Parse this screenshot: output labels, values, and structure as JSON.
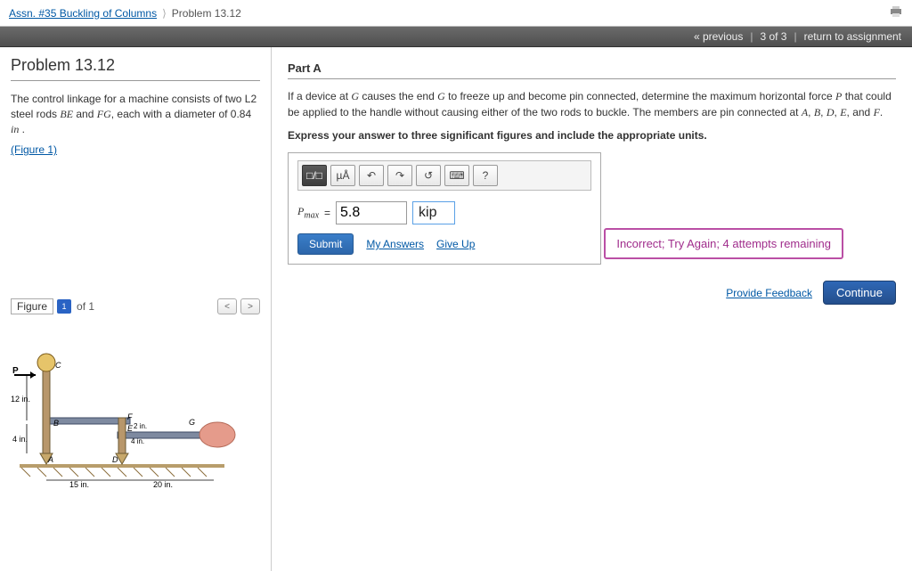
{
  "breadcrumb": {
    "assignment": "Assn. #35 Buckling of Columns",
    "here": "Problem 13.12"
  },
  "navbar": {
    "prev": "« previous",
    "pos": "3 of 3",
    "ret": "return to assignment"
  },
  "problem": {
    "title": "Problem 13.12",
    "statement_a": "The control linkage for a machine consists of two L2 steel rods ",
    "rod1": "BE",
    "statement_b": " and ",
    "rod2": "FG",
    "statement_c": ", each with a diameter of 0.84 ",
    "unitword": "in",
    "statement_d": " .",
    "fig_link": "(Figure 1)"
  },
  "figbar": {
    "label": "Figure",
    "current": "1",
    "of": "of 1",
    "prev": "<",
    "next": ">"
  },
  "figure_annot": {
    "P": "P",
    "C": "C",
    "B": "B",
    "A": "A",
    "D": "D",
    "E": "E",
    "F": "F",
    "G": "G",
    "h12": "12 in.",
    "h4": "4 in.",
    "e2": "2 in.",
    "e4": "4 in.",
    "w15": "15 in.",
    "w20": "20 in."
  },
  "partA": {
    "header": "Part A",
    "q1": "If a device at ",
    "G": "G",
    "q2": " causes the end ",
    "G2": "G",
    "q3": " to freeze up and become pin connected, determine the maximum horizontal force ",
    "P": "P",
    "q4": " that could be applied to the handle without causing either of the two rods to buckle. The members are pin connected at ",
    "pinsA": "A",
    "pinsB": "B",
    "pinsD": "D",
    "pinsE": "E",
    "pinsF": "F",
    "q5": ", and ",
    "q6": ".",
    "sep": ", ",
    "instruct": "Express your answer to three significant figures and include the appropriate units."
  },
  "toolbar": {
    "frac": "□/□",
    "mu": "µÅ",
    "undo": "↶",
    "redo": "↷",
    "reset": "↺",
    "kbd": "⌨",
    "help": "?"
  },
  "answer": {
    "var": "P",
    "sub": "max",
    "eq": "=",
    "value": "5.8",
    "unit": "kip"
  },
  "buttons": {
    "submit": "Submit",
    "myans": "My Answers",
    "giveup": "Give Up"
  },
  "result": "Incorrect; Try Again; 4 attempts remaining",
  "feedback": "Provide Feedback",
  "cont": "Continue"
}
